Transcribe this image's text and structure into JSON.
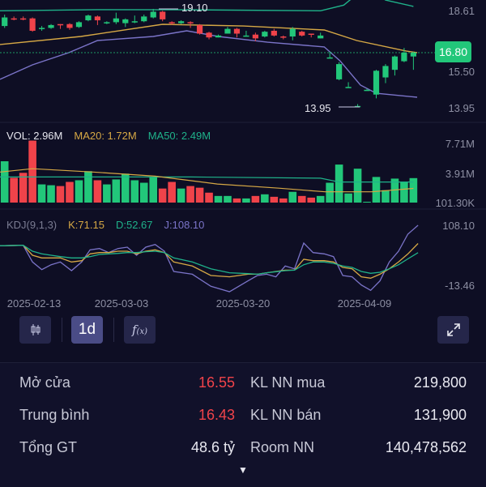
{
  "colors": {
    "up": "#22c77a",
    "down": "#f0434a",
    "upper_band": "#1fb28a",
    "mid_band": "#d6a845",
    "lower_band": "#7b74c9",
    "ma20": "#d6a845",
    "ma50": "#1fb28a",
    "k": "#d6a845",
    "d": "#1fb28a",
    "j": "#7b74c9"
  },
  "chart_data": [
    {
      "type": "candlestick",
      "price_axis_labels": [
        "18.61",
        "15.50",
        "13.95"
      ],
      "last_price": "16.80",
      "high_label": "19.10",
      "low_label": "13.95",
      "candles": [
        [
          18.2,
          18.8,
          18.1,
          18.65
        ],
        [
          18.6,
          18.7,
          18.5,
          18.55
        ],
        [
          18.6,
          18.7,
          18.5,
          18.55
        ],
        [
          18.6,
          18.65,
          17.9,
          17.95
        ],
        [
          18.05,
          18.2,
          17.95,
          18.1
        ],
        [
          18.1,
          18.3,
          18.05,
          18.25
        ],
        [
          18.3,
          18.3,
          18.05,
          18.25
        ],
        [
          18.3,
          18.35,
          18.0,
          18.1
        ],
        [
          18.15,
          18.45,
          18.1,
          18.4
        ],
        [
          18.5,
          18.8,
          18.45,
          18.75
        ],
        [
          18.7,
          18.75,
          18.25,
          18.5
        ],
        [
          18.35,
          18.45,
          18.3,
          18.4
        ],
        [
          18.4,
          18.9,
          18.3,
          18.6
        ],
        [
          18.35,
          18.6,
          18.15,
          18.55
        ],
        [
          18.4,
          18.75,
          18.35,
          18.45
        ],
        [
          18.45,
          18.8,
          18.4,
          18.7
        ],
        [
          18.65,
          19.1,
          18.6,
          18.95
        ],
        [
          18.95,
          19.0,
          18.45,
          18.55
        ],
        [
          18.4,
          18.45,
          18.25,
          18.35
        ],
        [
          18.35,
          18.5,
          18.3,
          18.45
        ],
        [
          18.4,
          18.45,
          18.1,
          18.35
        ],
        [
          18.25,
          18.3,
          17.75,
          17.8
        ],
        [
          17.85,
          17.9,
          17.5,
          17.6
        ],
        [
          17.6,
          17.75,
          17.6,
          17.7
        ],
        [
          17.8,
          18.15,
          17.8,
          18.05
        ],
        [
          18.05,
          18.1,
          17.6,
          17.8
        ],
        [
          17.65,
          17.95,
          17.65,
          17.7
        ],
        [
          17.75,
          17.85,
          17.4,
          17.55
        ],
        [
          17.65,
          17.95,
          17.6,
          17.9
        ],
        [
          17.95,
          18.05,
          17.65,
          17.7
        ],
        [
          17.65,
          17.7,
          17.5,
          17.6
        ],
        [
          17.65,
          18.15,
          17.45,
          18.05
        ],
        [
          17.9,
          17.95,
          17.65,
          17.7
        ],
        [
          17.8,
          17.8,
          17.6,
          17.75
        ],
        [
          17.55,
          17.85,
          17.55,
          17.7
        ],
        [
          16.5,
          16.85,
          16.5,
          16.55
        ],
        [
          15.4,
          16.3,
          15.35,
          16.2
        ],
        [
          14.95,
          15.25,
          14.95,
          15.0
        ],
        [
          13.98,
          14.1,
          13.95,
          14.0
        ],
        [
          14.8,
          14.9,
          14.8,
          14.85
        ],
        [
          14.6,
          15.9,
          14.4,
          15.85
        ],
        [
          15.5,
          16.2,
          15.2,
          16.1
        ],
        [
          15.9,
          16.65,
          15.6,
          16.6
        ],
        [
          16.35,
          17.05,
          16.3,
          16.8
        ],
        [
          16.6,
          16.85,
          15.9,
          16.8
        ]
      ],
      "upper_band": [
        [
          -0.5,
          19.0
        ],
        [
          10,
          19.06
        ],
        [
          20,
          19.05
        ],
        [
          34,
          19.0
        ],
        [
          36.5,
          19.3
        ],
        [
          38,
          19.9
        ],
        [
          40,
          19.9
        ],
        [
          41,
          19.56
        ],
        [
          44,
          19.23
        ]
      ],
      "middle_band": [
        [
          -0.5,
          17.23
        ],
        [
          8.2,
          17.65
        ],
        [
          17,
          18.29
        ],
        [
          25.7,
          18.2
        ],
        [
          34.4,
          17.99
        ],
        [
          37.9,
          17.44
        ],
        [
          43.2,
          16.89
        ],
        [
          44.4,
          16.8
        ]
      ],
      "lower_band": [
        [
          -0.5,
          15.4
        ],
        [
          3,
          16.16
        ],
        [
          6.9,
          16.8
        ],
        [
          10,
          17.44
        ],
        [
          16,
          17.65
        ],
        [
          19.6,
          17.95
        ],
        [
          23,
          17.65
        ],
        [
          28.3,
          17.35
        ],
        [
          34.4,
          17.1
        ],
        [
          36.1,
          16.37
        ],
        [
          38.3,
          15.1
        ],
        [
          40,
          14.67
        ],
        [
          44.4,
          14.46
        ]
      ]
    },
    {
      "type": "bar",
      "legend": {
        "vol": "VOL: 2.96M",
        "ma20": "MA20: 1.72M",
        "ma50": "MA50: 2.49M"
      },
      "axis_labels": [
        "7.71M",
        "3.91M",
        "101.30K"
      ],
      "unit": "M",
      "volumes": [
        5.0,
        3.0,
        3.6,
        7.5,
        2.2,
        2.1,
        2.0,
        2.5,
        2.7,
        3.8,
        2.7,
        2.2,
        2.8,
        3.5,
        2.7,
        2.4,
        3.1,
        1.7,
        2.5,
        1.7,
        2.0,
        1.8,
        1.2,
        0.8,
        0.8,
        0.5,
        0.5,
        0.8,
        1.0,
        0.7,
        0.5,
        1.3,
        0.8,
        0.6,
        0.8,
        2.4,
        4.6,
        1.1,
        4.1,
        0.1,
        3.1,
        1.5,
        2.9,
        2.5,
        2.96
      ],
      "ma20": [
        [
          -0.5,
          3.7
        ],
        [
          3,
          4.1
        ],
        [
          9.5,
          3.7
        ],
        [
          16.2,
          3.2
        ],
        [
          22.9,
          2.25
        ],
        [
          29.5,
          1.75
        ],
        [
          34.5,
          1.3
        ],
        [
          39.5,
          1.3
        ],
        [
          44,
          1.72
        ]
      ],
      "ma50": [
        [
          -0.5,
          3.1
        ],
        [
          20,
          3.1
        ],
        [
          34,
          2.95
        ],
        [
          36,
          2.49
        ],
        [
          44,
          2.49
        ]
      ]
    },
    {
      "type": "line",
      "legend": {
        "name": "KDJ(9,1,3)",
        "k": "K:71.15",
        "d": "D:52.67",
        "j": "J:108.10"
      },
      "axis_labels": [
        "108.10",
        "-13.46"
      ],
      "x": [
        -0.5,
        2,
        3,
        4,
        5,
        6,
        7.2,
        8.3,
        9.2,
        10.2,
        11.2,
        12.2,
        13.2,
        14.2,
        15.2,
        16.2,
        17.2,
        18.2,
        20.2,
        22.2,
        24.2,
        26.2,
        27.2,
        28.2,
        29.2,
        30.2,
        31.2,
        32.2,
        33.2,
        34.4,
        35.4,
        36.4,
        37.4,
        38.4,
        39.4,
        40.4,
        41.4,
        42.4,
        43.4,
        44.5
      ],
      "K": [
        66.5,
        67.6,
        47.3,
        41.9,
        41.9,
        41.9,
        33.7,
        36.4,
        50.1,
        52.8,
        52.8,
        55.6,
        55.6,
        50.1,
        55.6,
        58.3,
        52.8,
        33.7,
        25.5,
        6.3,
        3.6,
        9.0,
        9.0,
        11.8,
        14.5,
        17.2,
        17.2,
        39.1,
        36.4,
        36.4,
        33.7,
        22.7,
        20.0,
        3.6,
        0.8,
        9.0,
        20.0,
        33.7,
        50.0,
        71.15
      ],
      "D": [
        66.5,
        67.6,
        55.6,
        50.1,
        47.3,
        44.6,
        41.9,
        41.9,
        44.6,
        49.0,
        50.1,
        51.2,
        52.8,
        52.8,
        54.5,
        55.6,
        52.8,
        41.9,
        33.7,
        20.0,
        11.8,
        10.1,
        9.0,
        11.8,
        14.0,
        16.2,
        17.2,
        28.2,
        33.7,
        33.7,
        30.9,
        25.5,
        22.7,
        14.5,
        10.7,
        12.9,
        20.0,
        28.2,
        40.0,
        52.67
      ],
      "J": [
        66.5,
        67.6,
        33.7,
        18.3,
        28.2,
        33.7,
        16.2,
        33.7,
        58.3,
        61.0,
        52.8,
        61.0,
        63.8,
        47.3,
        63.8,
        69.2,
        55.6,
        14.5,
        9.0,
        -15.6,
        -26.5,
        -4.6,
        6.3,
        9.0,
        3.6,
        25.5,
        20.0,
        72.0,
        52.8,
        50.1,
        44.6,
        6.3,
        3.6,
        -12.9,
        -23.8,
        -4.6,
        33.7,
        55.6,
        90.0,
        108.1
      ]
    }
  ],
  "dates": [
    "2025-02-13",
    "2025-03-03",
    "2025-03-20",
    "2025-04-09"
  ],
  "toolbar": {
    "candle_type_icon": "candlestick-icon",
    "interval": "1d",
    "indicator_icon": "function-icon",
    "expand_icon": "expand-icon"
  },
  "stats": [
    {
      "label": "Mở cửa",
      "value": "16.55",
      "value_color": "red",
      "label2": "KL NN mua",
      "value2": "219,800"
    },
    {
      "label": "Trung bình",
      "value": "16.43",
      "value_color": "red",
      "label2": "KL NN bán",
      "value2": "131,900"
    },
    {
      "label": "Tổng GT",
      "value": "48.6 tỷ",
      "value_color": "white",
      "label2": "Room NN",
      "value2": "140,478,562"
    }
  ],
  "more_icon": "caret-down-icon"
}
